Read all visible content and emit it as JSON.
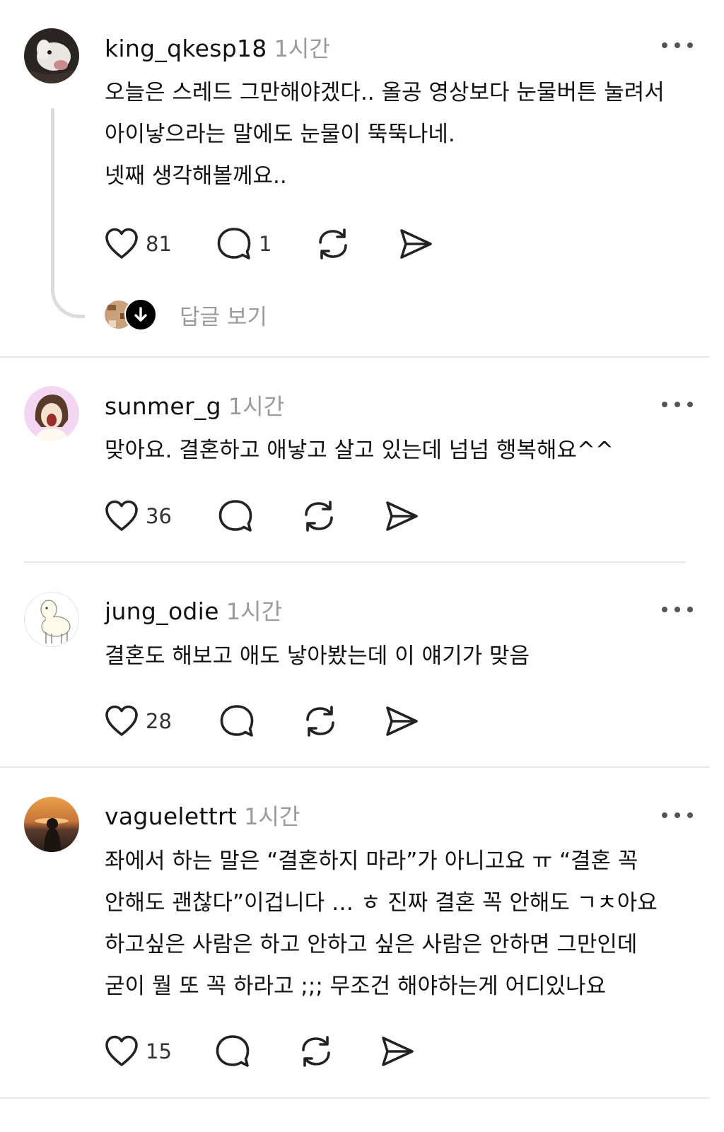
{
  "posts": [
    {
      "username": "king_qkesp18",
      "time": "1시간",
      "lines": [
        "오늘은 스레드 그만해야겠다.. 올공 영상보다 눈물버튼 눌려서",
        "아이낳으라는 말에도 눈물이 뚝뚝나네.",
        "넷째 생각해볼께요.."
      ],
      "likes": "81",
      "comments": "1",
      "view_replies": "답글 보기"
    },
    {
      "username": "sunmer_g",
      "time": "1시간",
      "lines": [
        "맞아요. 결혼하고 애낳고 살고 있는데 넘넘 행복해요^^"
      ],
      "likes": "36",
      "comments": ""
    },
    {
      "username": "jung_odie",
      "time": "1시간",
      "lines": [
        "결혼도 해보고 애도 낳아봤는데 이 얘기가 맞음"
      ],
      "likes": "28",
      "comments": ""
    },
    {
      "username": "vaguelettrt",
      "time": "1시간",
      "lines": [
        "좌에서 하는 말은 “결혼하지 마라”가 아니고요 ㅠ “결혼 꼭",
        "안해도 괜찮다”이겁니다 … ㅎ 진짜 결혼 꼭 안해도 ㄱㅊ아요",
        "하고싶은 사람은 하고 안하고 싶은 사람은 안하면 그만인데",
        "굳이 뭘 또 꼭 하라고 ;;; 무조건 해야하는게 어디있나요"
      ],
      "likes": "15",
      "comments": ""
    }
  ],
  "icons": {
    "like": "heart-icon",
    "comment": "comment-bubble-icon",
    "repost": "repost-icon",
    "share": "send-icon",
    "more": "more-options-icon",
    "expand": "arrow-down-icon"
  }
}
